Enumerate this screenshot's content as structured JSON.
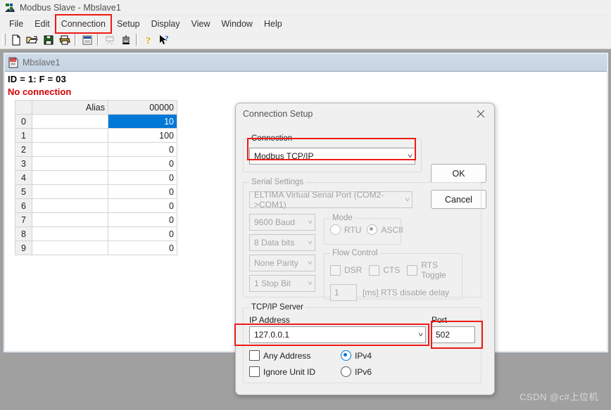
{
  "window": {
    "title": "Modbus Slave - Mbslave1",
    "app_icon": "modbus-slave-icon"
  },
  "menubar": {
    "items": [
      {
        "label": "File",
        "highlighted": false
      },
      {
        "label": "Edit",
        "highlighted": false
      },
      {
        "label": "Connection",
        "highlighted": true
      },
      {
        "label": "Setup",
        "highlighted": false
      },
      {
        "label": "Display",
        "highlighted": false
      },
      {
        "label": "View",
        "highlighted": false
      },
      {
        "label": "Window",
        "highlighted": false
      },
      {
        "label": "Help",
        "highlighted": false
      }
    ]
  },
  "toolbar": {
    "buttons": [
      {
        "icon": "new-document-icon"
      },
      {
        "icon": "open-folder-icon"
      },
      {
        "icon": "save-floppy-icon"
      },
      {
        "icon": "print-icon"
      },
      {
        "icon": "separator"
      },
      {
        "icon": "window-definition-icon"
      },
      {
        "icon": "separator"
      },
      {
        "icon": "connect-icon"
      },
      {
        "icon": "disconnect-icon"
      },
      {
        "icon": "separator"
      },
      {
        "icon": "help-question-icon"
      },
      {
        "icon": "context-help-arrow-icon"
      }
    ]
  },
  "mdi_child": {
    "title": "Mbslave1",
    "doc_icon": "document-icon",
    "slave_info": "ID = 1: F = 03",
    "status": "No connection",
    "grid": {
      "headers": [
        "",
        "Alias",
        "00000"
      ],
      "rows": [
        {
          "index": "0",
          "alias": "",
          "value": "10",
          "selected": true
        },
        {
          "index": "1",
          "alias": "",
          "value": "100",
          "selected": false
        },
        {
          "index": "2",
          "alias": "",
          "value": "0",
          "selected": false
        },
        {
          "index": "3",
          "alias": "",
          "value": "0",
          "selected": false
        },
        {
          "index": "4",
          "alias": "",
          "value": "0",
          "selected": false
        },
        {
          "index": "5",
          "alias": "",
          "value": "0",
          "selected": false
        },
        {
          "index": "6",
          "alias": "",
          "value": "0",
          "selected": false
        },
        {
          "index": "7",
          "alias": "",
          "value": "0",
          "selected": false
        },
        {
          "index": "8",
          "alias": "",
          "value": "0",
          "selected": false
        },
        {
          "index": "9",
          "alias": "",
          "value": "0",
          "selected": false
        }
      ]
    }
  },
  "dialog": {
    "title": "Connection Setup",
    "close_icon": "close-x-icon",
    "buttons": {
      "ok": "OK",
      "cancel": "Cancel"
    },
    "connection_group": {
      "legend": "Connection",
      "selected": "Modbus TCP/IP"
    },
    "serial_group": {
      "legend": "Serial Settings",
      "port": "ELTIMA Virtual Serial Port (COM2->COM1)",
      "baud": "9600 Baud",
      "data_bits": "8 Data bits",
      "parity": "None Parity",
      "stop_bits": "1 Stop Bit",
      "mode": {
        "legend": "Mode",
        "options": [
          {
            "label": "RTU",
            "checked": false
          },
          {
            "label": "ASCII",
            "checked": true
          }
        ]
      },
      "flow_control": {
        "legend": "Flow Control",
        "checkboxes": [
          {
            "label": "DSR",
            "checked": false
          },
          {
            "label": "CTS",
            "checked": false
          },
          {
            "label": "RTS Toggle",
            "checked": false
          }
        ],
        "delay_value": "1",
        "delay_label": "[ms] RTS disable delay"
      }
    },
    "tcp_group": {
      "legend": "TCP/IP Server",
      "ip_label": "IP Address",
      "ip_value": "127.0.0.1",
      "port_label": "Port",
      "port_value": "502",
      "checkboxes": [
        {
          "label": "Any Address",
          "checked": false
        },
        {
          "label": "Ignore Unit ID",
          "checked": false
        }
      ],
      "ip_version": [
        {
          "label": "IPv4",
          "checked": true
        },
        {
          "label": "IPv6",
          "checked": false
        }
      ]
    }
  },
  "annotations": {
    "color": "#ee1b15",
    "boxes": [
      "connection-menu",
      "connection-combo",
      "ip-address-field",
      "port-field"
    ]
  },
  "watermark": {
    "text": "CSDN @c#上位机"
  }
}
